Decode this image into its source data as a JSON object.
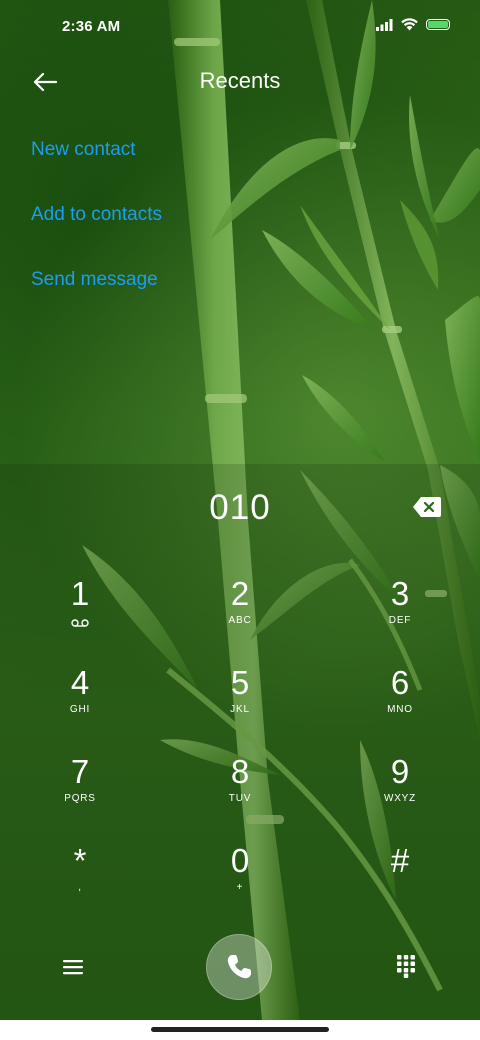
{
  "status_bar": {
    "time": "2:36 AM",
    "icons": [
      "signal-icon",
      "wifi-icon",
      "battery-icon"
    ],
    "battery_color": "#56d66b"
  },
  "header": {
    "title": "Recents",
    "back_icon": "back-arrow-icon"
  },
  "actions": {
    "new_contact": "New contact",
    "add_to_contacts": "Add to contacts",
    "send_message": "Send message",
    "link_color": "#1e9df0"
  },
  "dialer": {
    "number": "010",
    "backspace_icon": "backspace-icon",
    "keys": [
      {
        "digit": "1",
        "sub": "",
        "sub_icon": "voicemail-icon"
      },
      {
        "digit": "2",
        "sub": "ABC"
      },
      {
        "digit": "3",
        "sub": "DEF"
      },
      {
        "digit": "4",
        "sub": "GHI"
      },
      {
        "digit": "5",
        "sub": "JKL"
      },
      {
        "digit": "6",
        "sub": "MNO"
      },
      {
        "digit": "7",
        "sub": "PQRS"
      },
      {
        "digit": "8",
        "sub": "TUV"
      },
      {
        "digit": "9",
        "sub": "WXYZ"
      },
      {
        "digit": "*",
        "sub": ","
      },
      {
        "digit": "0",
        "sub": "+"
      },
      {
        "digit": "#",
        "sub": ""
      }
    ]
  },
  "bottom_bar": {
    "menu_icon": "menu-icon",
    "call_icon": "phone-icon",
    "keypad_icon": "dialpad-icon"
  }
}
